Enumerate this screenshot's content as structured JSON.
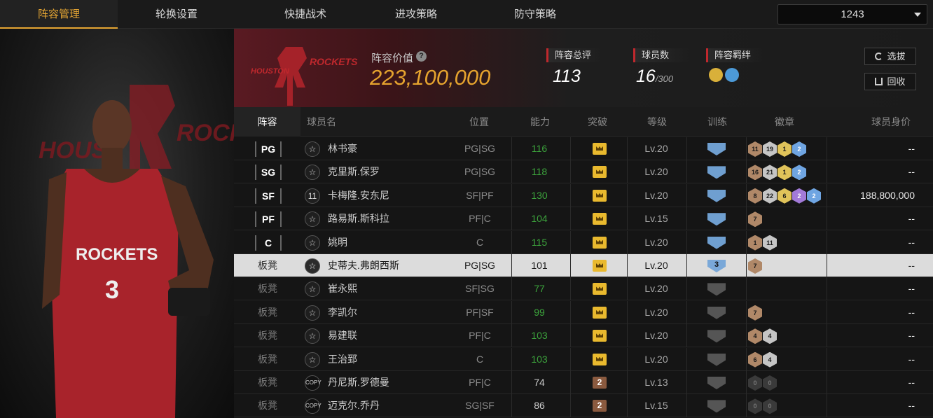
{
  "tabs": [
    "阵容管理",
    "轮换设置",
    "快捷战术",
    "进攻策略",
    "防守策略"
  ],
  "active_tab": 0,
  "server_select": {
    "value": "1243"
  },
  "header": {
    "value_label": "阵容价值",
    "value": "223,100,000",
    "overall_label": "阵容总评",
    "overall_value": "113",
    "players_label": "球员数",
    "players_value": "16",
    "players_max": "/300",
    "bond_label": "阵容羁绊",
    "select_button": "选拔",
    "recycle_button": "回收",
    "team_logo_text": "HOUSTON ROCKETS"
  },
  "table": {
    "headers": [
      "阵容",
      "球员名",
      "位置",
      "能力",
      "突破",
      "等级",
      "训练",
      "徽章",
      "球员身价"
    ],
    "rows": [
      {
        "slot": "PG",
        "name": "林书豪",
        "position": "PG|SG",
        "ability": "116",
        "green": true,
        "breakthrough": "crown",
        "level": "Lv.20",
        "training": "blue",
        "badges": [
          [
            "b",
            "11"
          ],
          [
            "s",
            "19"
          ],
          [
            "g",
            "1"
          ],
          [
            "bl",
            "2"
          ]
        ],
        "price": "--"
      },
      {
        "slot": "SG",
        "name": "克里斯.保罗",
        "position": "PG|SG",
        "ability": "118",
        "green": true,
        "breakthrough": "crown",
        "level": "Lv.20",
        "training": "blue",
        "badges": [
          [
            "b",
            "16"
          ],
          [
            "s",
            "21"
          ],
          [
            "g",
            "1"
          ],
          [
            "bl",
            "2"
          ]
        ],
        "price": "--"
      },
      {
        "slot": "SF",
        "name": "卡梅隆.安东尼",
        "position": "SF|PF",
        "ability": "130",
        "green": true,
        "breakthrough": "crown",
        "level": "Lv.20",
        "training": "blue",
        "badges": [
          [
            "b",
            "8"
          ],
          [
            "s",
            "22"
          ],
          [
            "g",
            "6"
          ],
          [
            "p",
            "2"
          ],
          [
            "bl",
            "2"
          ]
        ],
        "price": "188,800,000",
        "icon": "11"
      },
      {
        "slot": "PF",
        "name": "路易斯.斯科拉",
        "position": "PF|C",
        "ability": "104",
        "green": true,
        "breakthrough": "crown",
        "level": "Lv.15",
        "training": "blue",
        "badges": [
          [
            "b",
            "7"
          ]
        ],
        "price": "--"
      },
      {
        "slot": "C",
        "name": "姚明",
        "position": "C",
        "ability": "115",
        "green": true,
        "breakthrough": "crown",
        "level": "Lv.20",
        "training": "blue",
        "badges": [
          [
            "b",
            "1"
          ],
          [
            "s",
            "11"
          ]
        ],
        "price": "--"
      },
      {
        "slot": "板凳",
        "name": "史蒂夫.弗朗西斯",
        "position": "PG|SG",
        "ability": "101",
        "green": false,
        "breakthrough": "crown",
        "level": "Lv.20",
        "training": "3",
        "badges": [
          [
            "b",
            "7"
          ]
        ],
        "price": "--",
        "highlight": true
      },
      {
        "slot": "板凳",
        "name": "崔永熙",
        "position": "SF|SG",
        "ability": "77",
        "green": true,
        "breakthrough": "crown",
        "level": "Lv.20",
        "training": "grey",
        "badges": [],
        "price": "--"
      },
      {
        "slot": "板凳",
        "name": "李凯尔",
        "position": "PF|SF",
        "ability": "99",
        "green": true,
        "breakthrough": "crown",
        "level": "Lv.20",
        "training": "grey",
        "badges": [
          [
            "b",
            "7"
          ]
        ],
        "price": "--"
      },
      {
        "slot": "板凳",
        "name": "易建联",
        "position": "PF|C",
        "ability": "103",
        "green": true,
        "breakthrough": "crown",
        "level": "Lv.20",
        "training": "grey",
        "badges": [
          [
            "b",
            "4"
          ],
          [
            "s",
            "4"
          ]
        ],
        "price": "--"
      },
      {
        "slot": "板凳",
        "name": "王治郅",
        "position": "C",
        "ability": "103",
        "green": true,
        "breakthrough": "crown",
        "level": "Lv.20",
        "training": "grey",
        "badges": [
          [
            "b",
            "6"
          ],
          [
            "s",
            "4"
          ]
        ],
        "price": "--"
      },
      {
        "slot": "板凳",
        "name": "丹尼斯.罗德曼",
        "position": "PF|C",
        "ability": "74",
        "green": false,
        "breakthrough": "2",
        "level": "Lv.13",
        "training": "grey",
        "badges": [
          [
            "d",
            "0"
          ],
          [
            "d",
            "0"
          ]
        ],
        "price": "--",
        "copy": true
      },
      {
        "slot": "板凳",
        "name": "迈克尔.乔丹",
        "position": "SG|SF",
        "ability": "86",
        "green": false,
        "breakthrough": "2",
        "level": "Lv.15",
        "training": "grey",
        "badges": [
          [
            "d",
            "0"
          ],
          [
            "d",
            "0"
          ]
        ],
        "price": "--",
        "copy": true
      }
    ]
  },
  "colors": {
    "accent": "#e6a633",
    "ability_green": "#3ca33c",
    "rockets_red": "#c0282d"
  }
}
